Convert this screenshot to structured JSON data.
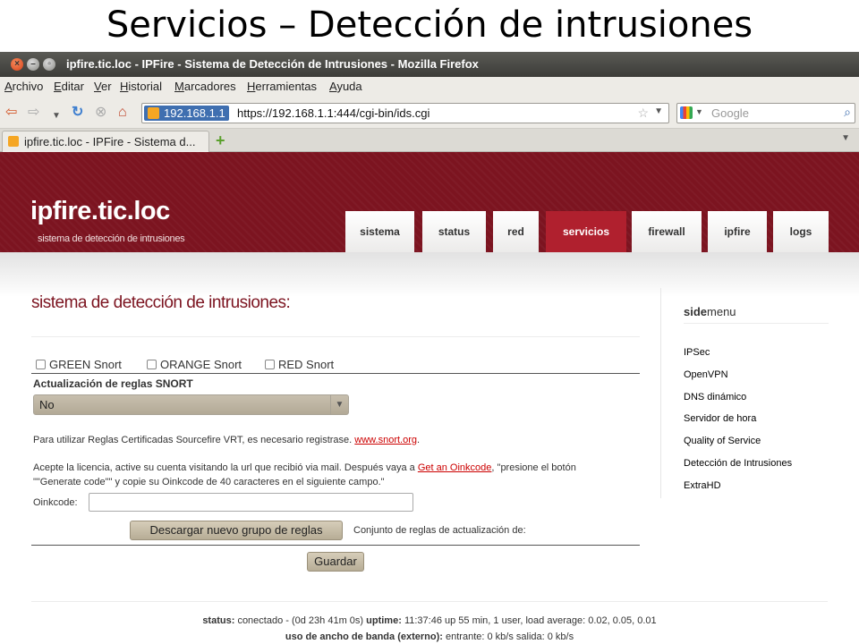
{
  "slide_title": "Servicios – Detección de intrusiones",
  "window": {
    "title": "ipfire.tic.loc - IPFire - Sistema de Detección de Intrusiones - Mozilla Firefox"
  },
  "menu": [
    "Archivo",
    "Editar",
    "Ver",
    "Historial",
    "Marcadores",
    "Herramientas",
    "Ayuda"
  ],
  "toolbar": {
    "host": "192.168.1.1",
    "url": "https://192.168.1.1:444/cgi-bin/ids.cgi",
    "search_placeholder": "Google",
    "icons": [
      "back-icon",
      "forward-icon",
      "history-dropdown-icon",
      "reload-icon",
      "stop-icon",
      "home-icon",
      "bookmark-star-icon",
      "search-icon"
    ]
  },
  "tab": {
    "title": "ipfire.tic.loc - IPFire - Sistema d..."
  },
  "site": {
    "name": "ipfire.tic.loc",
    "subtitle": "sistema de detección de intrusiones",
    "nav": [
      "sistema",
      "status",
      "red",
      "servicios",
      "firewall",
      "ipfire",
      "logs"
    ],
    "active_nav": "servicios",
    "accent": "#7c1420"
  },
  "main": {
    "heading": "sistema de detección de intrusiones:",
    "checks": [
      "GREEN Snort",
      "ORANGE Snort",
      "RED Snort"
    ],
    "update_label": "Actualización de reglas SNORT",
    "update_value": "No",
    "para1_text": "Para utilizar Reglas Certificadas Sourcefire VRT, es necesario registrase.",
    "para1_link": "www.snort.org",
    "para1_end": ".",
    "para2_a": "Acepte la licencia, active su cuenta visitando la url que recibió via mail. Después vaya a",
    "para2_link": "Get an Oinkcode",
    "para2_b": ", \"presione el botón \"\"Generate code\"\" y copie su Oinkcode de 40 caracteres en el siguiente campo.\"",
    "oinkcode_label": "Oinkcode:",
    "oinkcode_value": "",
    "download_button": "Descargar nuevo grupo de reglas",
    "ruleset_label": "Conjunto de reglas de actualización de:",
    "save_button": "Guardar"
  },
  "sidemenu": {
    "title_bold": "side",
    "title_rest": "menu",
    "items": [
      "IPSec",
      "OpenVPN",
      "DNS dinámico",
      "Servidor de hora",
      "Quality of Service",
      "Detección de Intrusiones",
      "ExtraHD"
    ]
  },
  "footer": {
    "status_label": "status:",
    "status_text": "conectado - (0d 23h 41m 0s)",
    "uptime_label": "uptime:",
    "uptime_text": "11:37:46 up 55 min, 1 user, load average: 0.02, 0.05, 0.01",
    "bw_label": "uso de ancho de banda (externo):",
    "bw_text": "entrante: 0 kb/s salida: 0 kb/s"
  }
}
